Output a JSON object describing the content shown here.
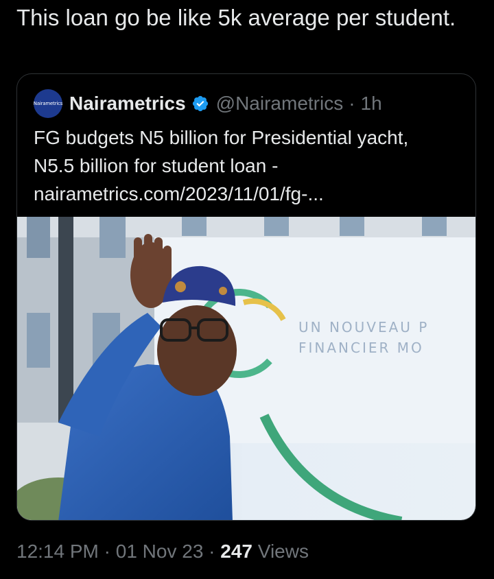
{
  "tweet": {
    "text": "This loan go be like 5k average per student."
  },
  "quote": {
    "avatar_logo": "Nairametrics",
    "display_name": "Nairametrics",
    "verified_icon": "verified-badge-icon",
    "handle": "@Nairametrics",
    "separator": "·",
    "time": "1h",
    "text_line1": "FG budgets N5 billion for Presidential yacht,",
    "text_line2": "N5.5 billion for student loan -",
    "text_line3": "nairametrics.com/2023/11/01/fg-...",
    "media_sign_text": [
      "UN NOUVEAU P",
      "FINANCIER MO"
    ]
  },
  "footer": {
    "time": "12:14 PM",
    "sep1": "·",
    "date": "01 Nov 23",
    "sep2": "·",
    "views_count": "247",
    "views_label": "Views"
  },
  "colors": {
    "background": "#000000",
    "primary_text": "#e7e9ea",
    "secondary_text": "#71767b",
    "border": "#2f3336",
    "verified_blue": "#1d9bf0"
  }
}
